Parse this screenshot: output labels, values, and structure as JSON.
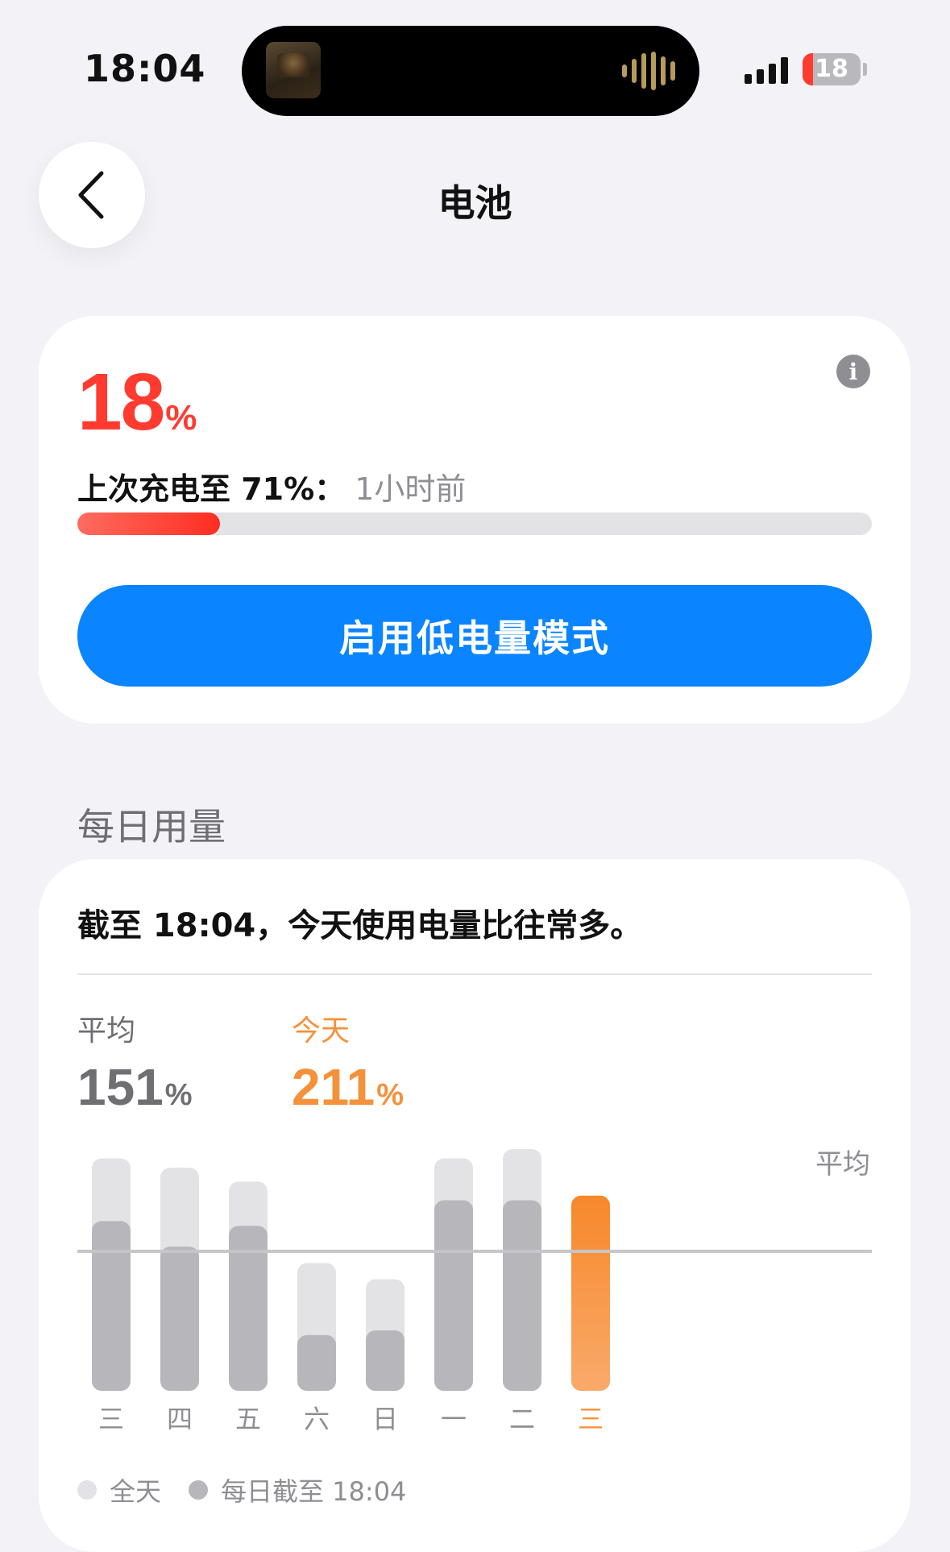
{
  "status_bar": {
    "time": "18:04",
    "battery_level": 18,
    "battery_text": "18"
  },
  "nav": {
    "title": "电池"
  },
  "battery": {
    "percent_value": "18",
    "percent_unit": "%",
    "last_charge_label": "上次充电至 71%：",
    "last_charge_time": "1小时前",
    "level_fraction": 0.18,
    "low_power_button": "启用低电量模式",
    "accent_color": "#ff3b30"
  },
  "daily_usage": {
    "section_title": "每日用量",
    "summary": "截至 18:04，今天使用电量比往常多。",
    "average_label": "平均",
    "average_value": "151",
    "average_unit": "%",
    "today_label": "今天",
    "today_value": "211",
    "today_unit": "%",
    "chart_avg_label": "平均",
    "legend_full_day": "全天",
    "legend_until_now": "每日截至 18:04",
    "colors": {
      "full_day": "#e3e3e6",
      "until_now": "#b7b7bb",
      "today": "#f7923a",
      "average_line": "#c6c6ca"
    }
  },
  "chart_data": {
    "type": "bar",
    "categories": [
      "三",
      "四",
      "五",
      "六",
      "日",
      "一",
      "二",
      "三"
    ],
    "series": [
      {
        "name": "全天",
        "values": [
          100,
          96,
          90,
          55,
          48,
          100,
          104,
          null
        ]
      },
      {
        "name": "每日截至 18:04",
        "values": [
          73,
          62,
          71,
          24,
          26,
          82,
          82,
          84
        ]
      }
    ],
    "highlight_index": 7,
    "average_line": 60,
    "ylim": [
      0,
      104
    ]
  }
}
